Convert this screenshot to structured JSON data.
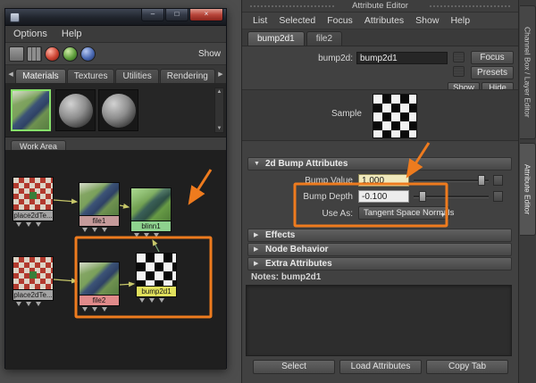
{
  "colors": {
    "annotation_orange": "#ee7b1e",
    "selection_green": "#86e06a",
    "node_blinn_green": "#8ed28e",
    "node_file_pink": "#e08a8a",
    "node_bump_yellow": "#e0e05c"
  },
  "hypershade": {
    "menus": [
      "Options",
      "Help"
    ],
    "toolbar_show_label": "Show",
    "tabs": [
      "Materials",
      "Textures",
      "Utilities",
      "Rendering"
    ],
    "work_area_tab_label": "Work Area",
    "nodes": [
      {
        "name": "place2dTe..."
      },
      {
        "name": "file1"
      },
      {
        "name": "blinn1"
      },
      {
        "name": "place2dTe..."
      },
      {
        "name": "file2"
      },
      {
        "name": "bump2d1"
      }
    ]
  },
  "attribute_editor": {
    "title": "Attribute Editor",
    "menus": [
      "List",
      "Selected",
      "Focus",
      "Attributes",
      "Show",
      "Help"
    ],
    "tabs": [
      "bump2d1",
      "file2"
    ],
    "node": {
      "type_label": "bump2d:",
      "name_value": "bump2d1"
    },
    "buttons": {
      "focus": "Focus",
      "presets": "Presets",
      "show": "Show",
      "hide": "Hide"
    },
    "sample_label": "Sample",
    "sections": {
      "bump": "2d Bump Attributes",
      "effects": "Effects",
      "node_behavior": "Node Behavior",
      "extra": "Extra Attributes"
    },
    "fields": {
      "bump_value": {
        "label": "Bump Value",
        "value": "1.000"
      },
      "bump_depth": {
        "label": "Bump Depth",
        "value": "-0.100"
      },
      "use_as": {
        "label": "Use As:",
        "value": "Tangent Space Normals"
      }
    },
    "notes_label": "Notes: bump2d1",
    "footer_buttons": [
      "Select",
      "Load Attributes",
      "Copy Tab"
    ]
  },
  "side_tabs": [
    "Channel Box / Layer Editor",
    "Attribute Editor"
  ]
}
